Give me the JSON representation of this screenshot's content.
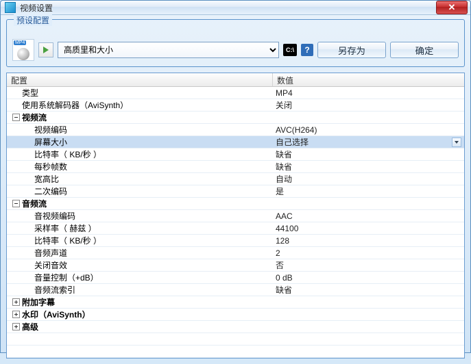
{
  "window": {
    "title": "视频设置",
    "close": "✕"
  },
  "presets": {
    "legend": "预设配置",
    "selected": "高质里和大小",
    "cmd": "C:\\",
    "help": "?",
    "saveas": "另存为",
    "ok": "确定"
  },
  "grid": {
    "head": {
      "config": "配置",
      "value": "数值"
    }
  },
  "rows": {
    "type": {
      "label": "类型",
      "value": "MP4"
    },
    "avisynth": {
      "label": "使用系统解码器（AviSynth）",
      "value": "关闭"
    },
    "video": {
      "label": "视频流"
    },
    "vcodec": {
      "label": "视频编码",
      "value": "AVC(H264)"
    },
    "screen": {
      "label": "屏幕大小",
      "value": "自己选择"
    },
    "vbitrate": {
      "label": "比特率（ KB/秒 ）",
      "value": "缺省"
    },
    "fps": {
      "label": "每秒帧数",
      "value": "缺省"
    },
    "aspect": {
      "label": "宽高比",
      "value": "自动"
    },
    "twopass": {
      "label": "二次编码",
      "value": "是"
    },
    "audio": {
      "label": "音频流"
    },
    "acodec": {
      "label": "音视频编码",
      "value": "AAC"
    },
    "srate": {
      "label": "采样率（ 赫兹 ）",
      "value": "44100"
    },
    "abitrate": {
      "label": "比特率（ KB/秒 ）",
      "value": "128"
    },
    "channels": {
      "label": "音频声道",
      "value": "2"
    },
    "mute": {
      "label": "关闭音效",
      "value": "否"
    },
    "volume": {
      "label": "音量控制（+dB）",
      "value": "0 dB"
    },
    "aindex": {
      "label": "音频流索引",
      "value": "缺省"
    },
    "subs": {
      "label": "附加字幕"
    },
    "wm": {
      "label": "水印（AviSynth）"
    },
    "adv": {
      "label": "高级"
    }
  }
}
